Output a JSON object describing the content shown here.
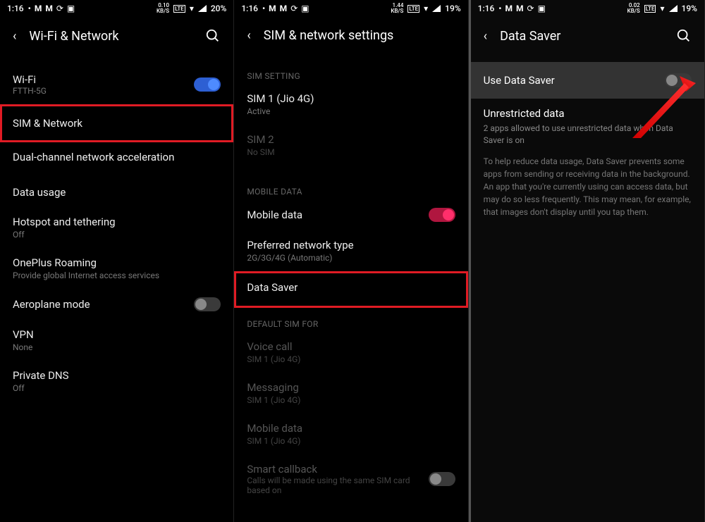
{
  "panel1": {
    "status": {
      "time": "1:16",
      "rate_top": "0.10",
      "rate_bot": "KB/S",
      "net": "LTE",
      "battery": "20%"
    },
    "header": {
      "title": "Wi-Fi & Network"
    },
    "wifi": {
      "label": "Wi-Fi",
      "sub": "FTTH-5G"
    },
    "sim": {
      "label": "SIM & Network"
    },
    "dual": {
      "label": "Dual-channel network acceleration"
    },
    "data_usage": {
      "label": "Data usage"
    },
    "hotspot": {
      "label": "Hotspot and tethering",
      "sub": "Off"
    },
    "roaming": {
      "label": "OnePlus Roaming",
      "sub": "Provide global Internet access services"
    },
    "aeroplane": {
      "label": "Aeroplane mode"
    },
    "vpn": {
      "label": "VPN",
      "sub": "None"
    },
    "dns": {
      "label": "Private DNS",
      "sub": "Off"
    }
  },
  "panel2": {
    "status": {
      "time": "1:16",
      "rate_top": "1.44",
      "rate_bot": "KB/S",
      "net": "LTE",
      "battery": "19%"
    },
    "header": {
      "title": "SIM & network settings"
    },
    "section_sim": "SIM SETTING",
    "sim1": {
      "label": "SIM 1 (Jio 4G)",
      "sub": "Active"
    },
    "sim2": {
      "label": "SIM 2",
      "sub": "No SIM"
    },
    "section_mobile": "MOBILE DATA",
    "mobile_data": {
      "label": "Mobile data"
    },
    "pref_net": {
      "label": "Preferred network type",
      "sub": "2G/3G/4G (Automatic)"
    },
    "data_saver": {
      "label": "Data Saver"
    },
    "section_default": "DEFAULT SIM FOR",
    "voice": {
      "label": "Voice call",
      "sub": "SIM 1 (Jio 4G)"
    },
    "messaging": {
      "label": "Messaging",
      "sub": "SIM 1 (Jio 4G)"
    },
    "mobile_data2": {
      "label": "Mobile data",
      "sub": "SIM 1 (Jio 4G)"
    },
    "smart": {
      "label": "Smart callback",
      "sub": "Calls will be made using the same SIM card based on"
    }
  },
  "panel3": {
    "status": {
      "time": "1:16",
      "rate_top": "0.02",
      "rate_bot": "KB/S",
      "net": "LTE",
      "battery": "19%"
    },
    "header": {
      "title": "Data Saver"
    },
    "use": {
      "label": "Use Data Saver"
    },
    "unrestricted": {
      "label": "Unrestricted data",
      "sub": "2 apps allowed to use unrestricted data when Data Saver is on"
    },
    "desc": "To help reduce data usage, Data Saver prevents some apps from sending or receiving data in the background. An app that you're currently using can access data, but may do so less frequently. This may mean, for example, that images don't display until you tap them."
  }
}
